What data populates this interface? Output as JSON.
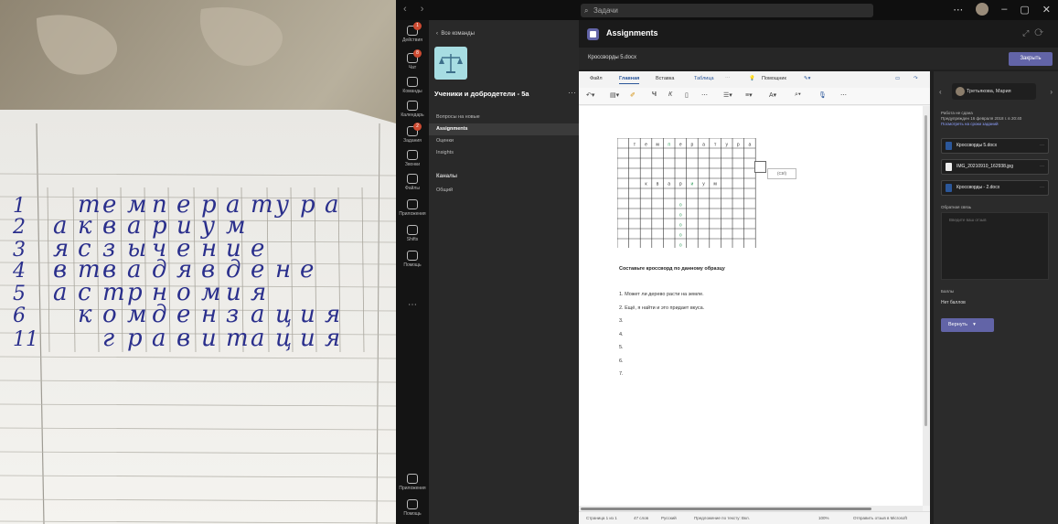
{
  "photo": {
    "rows": [
      {
        "num": "1",
        "letters": [
          "",
          "т",
          "е",
          "м",
          "п",
          "е",
          "р",
          "а",
          "т",
          "у",
          "р",
          "а"
        ]
      },
      {
        "num": "2",
        "letters": [
          "а",
          "к",
          "в",
          "а",
          "р",
          "и",
          "у",
          "м",
          "",
          "",
          "",
          ""
        ]
      },
      {
        "num": "3",
        "letters": [
          "я",
          "с",
          "з",
          "ы",
          "ч",
          "е",
          "н",
          "и",
          "е",
          "",
          "",
          ""
        ]
      },
      {
        "num": "4",
        "letters": [
          "в",
          "т",
          "в",
          "а",
          "д",
          "я",
          "в",
          "д",
          "е",
          "н",
          "е",
          ""
        ]
      },
      {
        "num": "5",
        "letters": [
          "а",
          "с",
          "т",
          "р",
          "н",
          "о",
          "м",
          "и",
          "я",
          "",
          "",
          ""
        ]
      },
      {
        "num": "6",
        "letters": [
          "",
          "к",
          "о",
          "м",
          "д",
          "е",
          "н",
          "з",
          "а",
          "ц",
          "и",
          "я"
        ]
      },
      {
        "num": "11",
        "letters": [
          "",
          "",
          "г",
          "р",
          "а",
          "в",
          "и",
          "т",
          "а",
          "ц",
          "и",
          "я"
        ]
      }
    ]
  },
  "titlebar": {
    "search_placeholder": "Задачи"
  },
  "rail": {
    "items": [
      {
        "label": "Действия",
        "badge": "1"
      },
      {
        "label": "Чат",
        "badge": "8"
      },
      {
        "label": "Команды",
        "badge": ""
      },
      {
        "label": "Календарь",
        "badge": ""
      },
      {
        "label": "Задания",
        "badge": "2"
      },
      {
        "label": "Звонки",
        "badge": ""
      },
      {
        "label": "Файлы",
        "badge": ""
      },
      {
        "label": "Приложения",
        "badge": ""
      },
      {
        "label": "Shifts",
        "badge": ""
      },
      {
        "label": "Помощь",
        "badge": ""
      }
    ],
    "bottom_apps": "Приложения",
    "bottom_help": "Помощь"
  },
  "nav": {
    "back_label": "Все команды",
    "team_name": "Ученики и добродетели - 5а",
    "links": [
      "Вопросы на новые",
      "Assignments",
      "Оценки",
      "Insights"
    ],
    "selected": "Assignments",
    "section": "Каналы",
    "channel": "Общий"
  },
  "header": {
    "title": "Assignments",
    "file_name": "Кроссворды 5.docx",
    "close_button": "Закрыть"
  },
  "word": {
    "tabs": [
      "Файл",
      "Главная",
      "Вставка",
      "Таблица",
      "Помощник"
    ],
    "selected_tab": "Главная",
    "paste_chip": "(Ctrl)",
    "heading": "Составьте кроссворд по данному образцу",
    "lines": [
      "1. Может ли дерево расти на земле.",
      "2. Ещё, я найти и это придает вкуса.",
      "3.",
      "4.",
      "5.",
      "6.",
      "7."
    ],
    "crossword_top_letters": [
      "т",
      "е",
      "м",
      "п",
      "е",
      "р",
      "а",
      "т",
      "у",
      "р",
      "а"
    ],
    "crossword_mid_letters": [
      "к",
      "в",
      "а",
      "р",
      "и",
      "у",
      "м"
    ],
    "status": {
      "page": "Страница 1 из 1",
      "words": "47 слов",
      "lang": "Русский",
      "predict": "Предложение по тексту: Вкл.",
      "zoom": "100%",
      "feedback": "Отправить отзыв в Microsoft"
    }
  },
  "rpanel": {
    "user": "Третьякова, Мария",
    "status_line1": "Работа не сдана",
    "status_line2": "Предупрежден 16 февраля 2018 г. в 20:40",
    "status_link": "Посмотреть на сроки заданий",
    "files": [
      "Кроссворды 5.docx",
      "IMG_20210910_162938.jpg",
      "Кроссворды - 2.docx"
    ],
    "feedback_label": "Обратная связь",
    "feedback_placeholder": "Введите ваш отзыв",
    "points_label": "Баллы",
    "points_value": "Нет баллов",
    "return_button": "Вернуть"
  },
  "colors": {
    "teams_purple": "#6264a7",
    "word_blue": "#2b579a",
    "ink": "#2a2f8c"
  }
}
